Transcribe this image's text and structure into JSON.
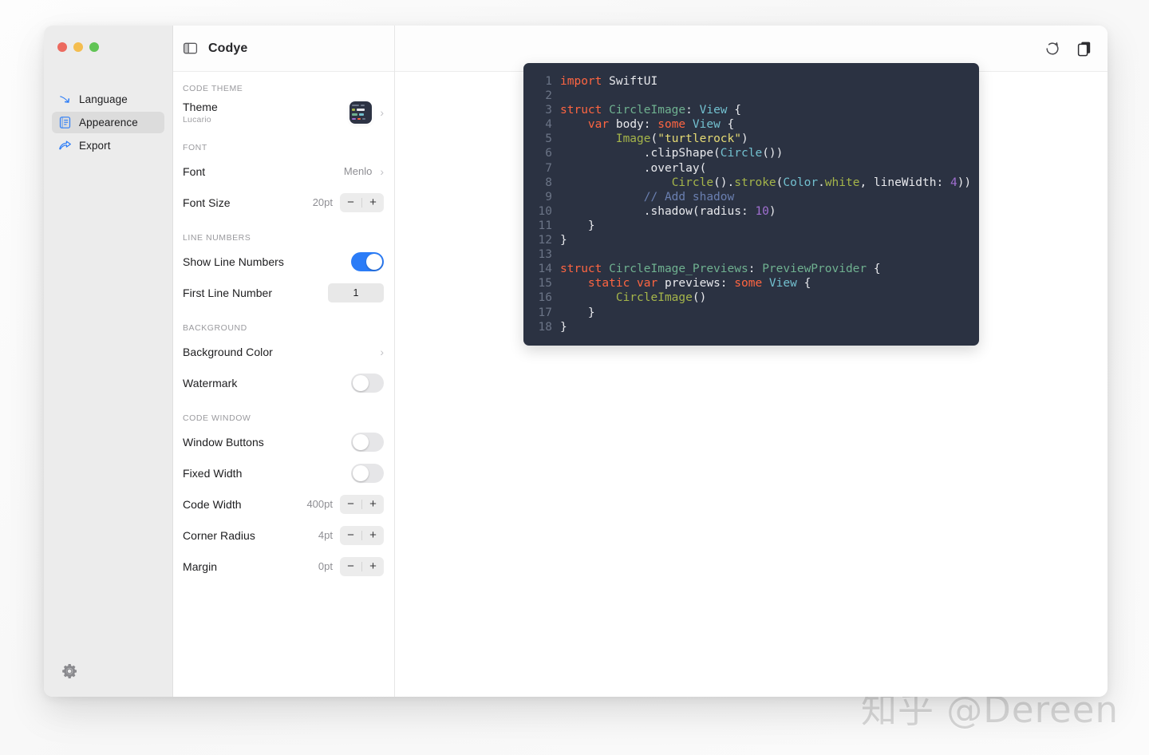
{
  "watermark": "知乎 @Dereen",
  "window": {
    "title": "Codye",
    "traffic_lights": [
      "close",
      "minimize",
      "zoom"
    ],
    "sidebar_toggle_icon": "sidebar-toggle-icon"
  },
  "sidebar": {
    "items": [
      {
        "label": "Language",
        "icon": "swift-arrow-icon",
        "active": false
      },
      {
        "label": "Appearence",
        "icon": "document-icon",
        "active": true
      },
      {
        "label": "Export",
        "icon": "share-arrow-icon",
        "active": false
      }
    ],
    "footer": {
      "icon": "gear-icon",
      "label": "Settings"
    }
  },
  "settings": {
    "sections": [
      {
        "label": "CODE THEME",
        "rows": [
          {
            "title": "Theme",
            "subtitle": "Lucario",
            "control": "thumbnail-chevron",
            "value": ""
          }
        ]
      },
      {
        "label": "FONT",
        "rows": [
          {
            "title": "Font",
            "subtitle": "",
            "control": "value-chevron",
            "value": "Menlo"
          },
          {
            "title": "Font Size",
            "subtitle": "",
            "control": "stepper",
            "value": "20pt"
          }
        ]
      },
      {
        "label": "LINE NUMBERS",
        "rows": [
          {
            "title": "Show Line Numbers",
            "subtitle": "",
            "control": "toggle",
            "value": "on"
          },
          {
            "title": "First Line Number",
            "subtitle": "",
            "control": "numfield",
            "value": "1"
          }
        ]
      },
      {
        "label": "BACKGROUND",
        "rows": [
          {
            "title": "Background Color",
            "subtitle": "",
            "control": "chevron",
            "value": ""
          },
          {
            "title": "Watermark",
            "subtitle": "",
            "control": "toggle",
            "value": "off"
          }
        ]
      },
      {
        "label": "CODE WINDOW",
        "rows": [
          {
            "title": "Window Buttons",
            "subtitle": "",
            "control": "toggle",
            "value": "off"
          },
          {
            "title": "Fixed Width",
            "subtitle": "",
            "control": "toggle",
            "value": "off"
          },
          {
            "title": "Code Width",
            "subtitle": "",
            "control": "stepper",
            "value": "400pt"
          },
          {
            "title": "Corner Radius",
            "subtitle": "",
            "control": "stepper",
            "value": "4pt"
          },
          {
            "title": "Margin",
            "subtitle": "",
            "control": "stepper",
            "value": "0pt"
          }
        ]
      }
    ],
    "stepper_minus": "−",
    "stepper_plus": "+",
    "chevron": "›"
  },
  "toolbar": {
    "refresh_icon": "refresh-icon",
    "copy_icon": "copy-icon"
  },
  "preview": {
    "language": "Swift",
    "theme": "Lucario",
    "code_lines": [
      {
        "n": "1",
        "tokens": [
          {
            "t": "import ",
            "c": "kw"
          },
          {
            "t": "SwiftUI",
            "c": "ctext"
          }
        ]
      },
      {
        "n": "2",
        "tokens": []
      },
      {
        "n": "3",
        "tokens": [
          {
            "t": "struct ",
            "c": "kw"
          },
          {
            "t": "CircleImage",
            "c": "type"
          },
          {
            "t": ": ",
            "c": "ctext"
          },
          {
            "t": "View",
            "c": "typ2"
          },
          {
            "t": " {",
            "c": "ctext"
          }
        ]
      },
      {
        "n": "4",
        "tokens": [
          {
            "t": "    ",
            "c": "ctext"
          },
          {
            "t": "var",
            "c": "kw"
          },
          {
            "t": " body: ",
            "c": "ctext"
          },
          {
            "t": "some",
            "c": "kw"
          },
          {
            "t": " ",
            "c": "ctext"
          },
          {
            "t": "View",
            "c": "typ2"
          },
          {
            "t": " {",
            "c": "ctext"
          }
        ]
      },
      {
        "n": "5",
        "tokens": [
          {
            "t": "        ",
            "c": "ctext"
          },
          {
            "t": "Image",
            "c": "fn"
          },
          {
            "t": "(",
            "c": "ctext"
          },
          {
            "t": "\"turtlerock\"",
            "c": "str"
          },
          {
            "t": ")",
            "c": "ctext"
          }
        ]
      },
      {
        "n": "6",
        "tokens": [
          {
            "t": "            .clipShape(",
            "c": "ctext"
          },
          {
            "t": "Circle",
            "c": "typ2"
          },
          {
            "t": "())",
            "c": "ctext"
          }
        ]
      },
      {
        "n": "7",
        "tokens": [
          {
            "t": "            .overlay(",
            "c": "ctext"
          }
        ]
      },
      {
        "n": "8",
        "tokens": [
          {
            "t": "                ",
            "c": "ctext"
          },
          {
            "t": "Circle",
            "c": "fn"
          },
          {
            "t": "().",
            "c": "ctext"
          },
          {
            "t": "stroke",
            "c": "fn"
          },
          {
            "t": "(",
            "c": "ctext"
          },
          {
            "t": "Color",
            "c": "typ2"
          },
          {
            "t": ".",
            "c": "ctext"
          },
          {
            "t": "white",
            "c": "fn"
          },
          {
            "t": ", lineWidth: ",
            "c": "ctext"
          },
          {
            "t": "4",
            "c": "num"
          },
          {
            "t": "))",
            "c": "ctext"
          }
        ]
      },
      {
        "n": "9",
        "tokens": [
          {
            "t": "            // Add shadow",
            "c": "cmt"
          }
        ]
      },
      {
        "n": "10",
        "tokens": [
          {
            "t": "            .shadow(radius: ",
            "c": "ctext"
          },
          {
            "t": "10",
            "c": "num"
          },
          {
            "t": ")",
            "c": "ctext"
          }
        ]
      },
      {
        "n": "11",
        "tokens": [
          {
            "t": "    }",
            "c": "ctext"
          }
        ]
      },
      {
        "n": "12",
        "tokens": [
          {
            "t": "}",
            "c": "ctext"
          }
        ]
      },
      {
        "n": "13",
        "tokens": []
      },
      {
        "n": "14",
        "tokens": [
          {
            "t": "struct ",
            "c": "kw"
          },
          {
            "t": "CircleImage_Previews",
            "c": "type"
          },
          {
            "t": ": ",
            "c": "ctext"
          },
          {
            "t": "PreviewProvider",
            "c": "type"
          },
          {
            "t": " {",
            "c": "ctext"
          }
        ]
      },
      {
        "n": "15",
        "tokens": [
          {
            "t": "    ",
            "c": "ctext"
          },
          {
            "t": "static var",
            "c": "kw"
          },
          {
            "t": " previews: ",
            "c": "ctext"
          },
          {
            "t": "some",
            "c": "kw"
          },
          {
            "t": " ",
            "c": "ctext"
          },
          {
            "t": "View",
            "c": "typ2"
          },
          {
            "t": " {",
            "c": "ctext"
          }
        ]
      },
      {
        "n": "16",
        "tokens": [
          {
            "t": "        ",
            "c": "ctext"
          },
          {
            "t": "CircleImage",
            "c": "fn"
          },
          {
            "t": "()",
            "c": "ctext"
          }
        ]
      },
      {
        "n": "17",
        "tokens": [
          {
            "t": "    }",
            "c": "ctext"
          }
        ]
      },
      {
        "n": "18",
        "tokens": [
          {
            "t": "}",
            "c": "ctext"
          }
        ]
      }
    ]
  },
  "colors": {
    "accent": "#2b7cf7",
    "code_background": "#2b3242",
    "rail_background": "#ececec",
    "active_item": "#dcdcdc"
  }
}
